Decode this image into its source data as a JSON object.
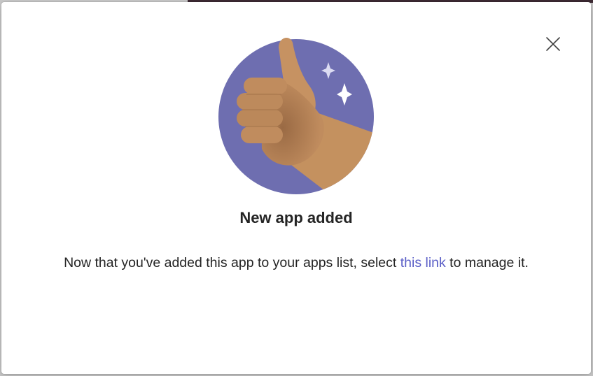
{
  "dialog": {
    "title": "New app added",
    "message_before": "Now that you've added this app to your apps list, select ",
    "link_text": "this link",
    "message_after": " to manage it.",
    "close_icon": "close-icon",
    "illustration_icon": "thumbs-up-icon"
  },
  "colors": {
    "accent": "#5b5fc7",
    "circle": "#6e6eb0",
    "skin": "#c08c5e",
    "text": "#242424"
  }
}
